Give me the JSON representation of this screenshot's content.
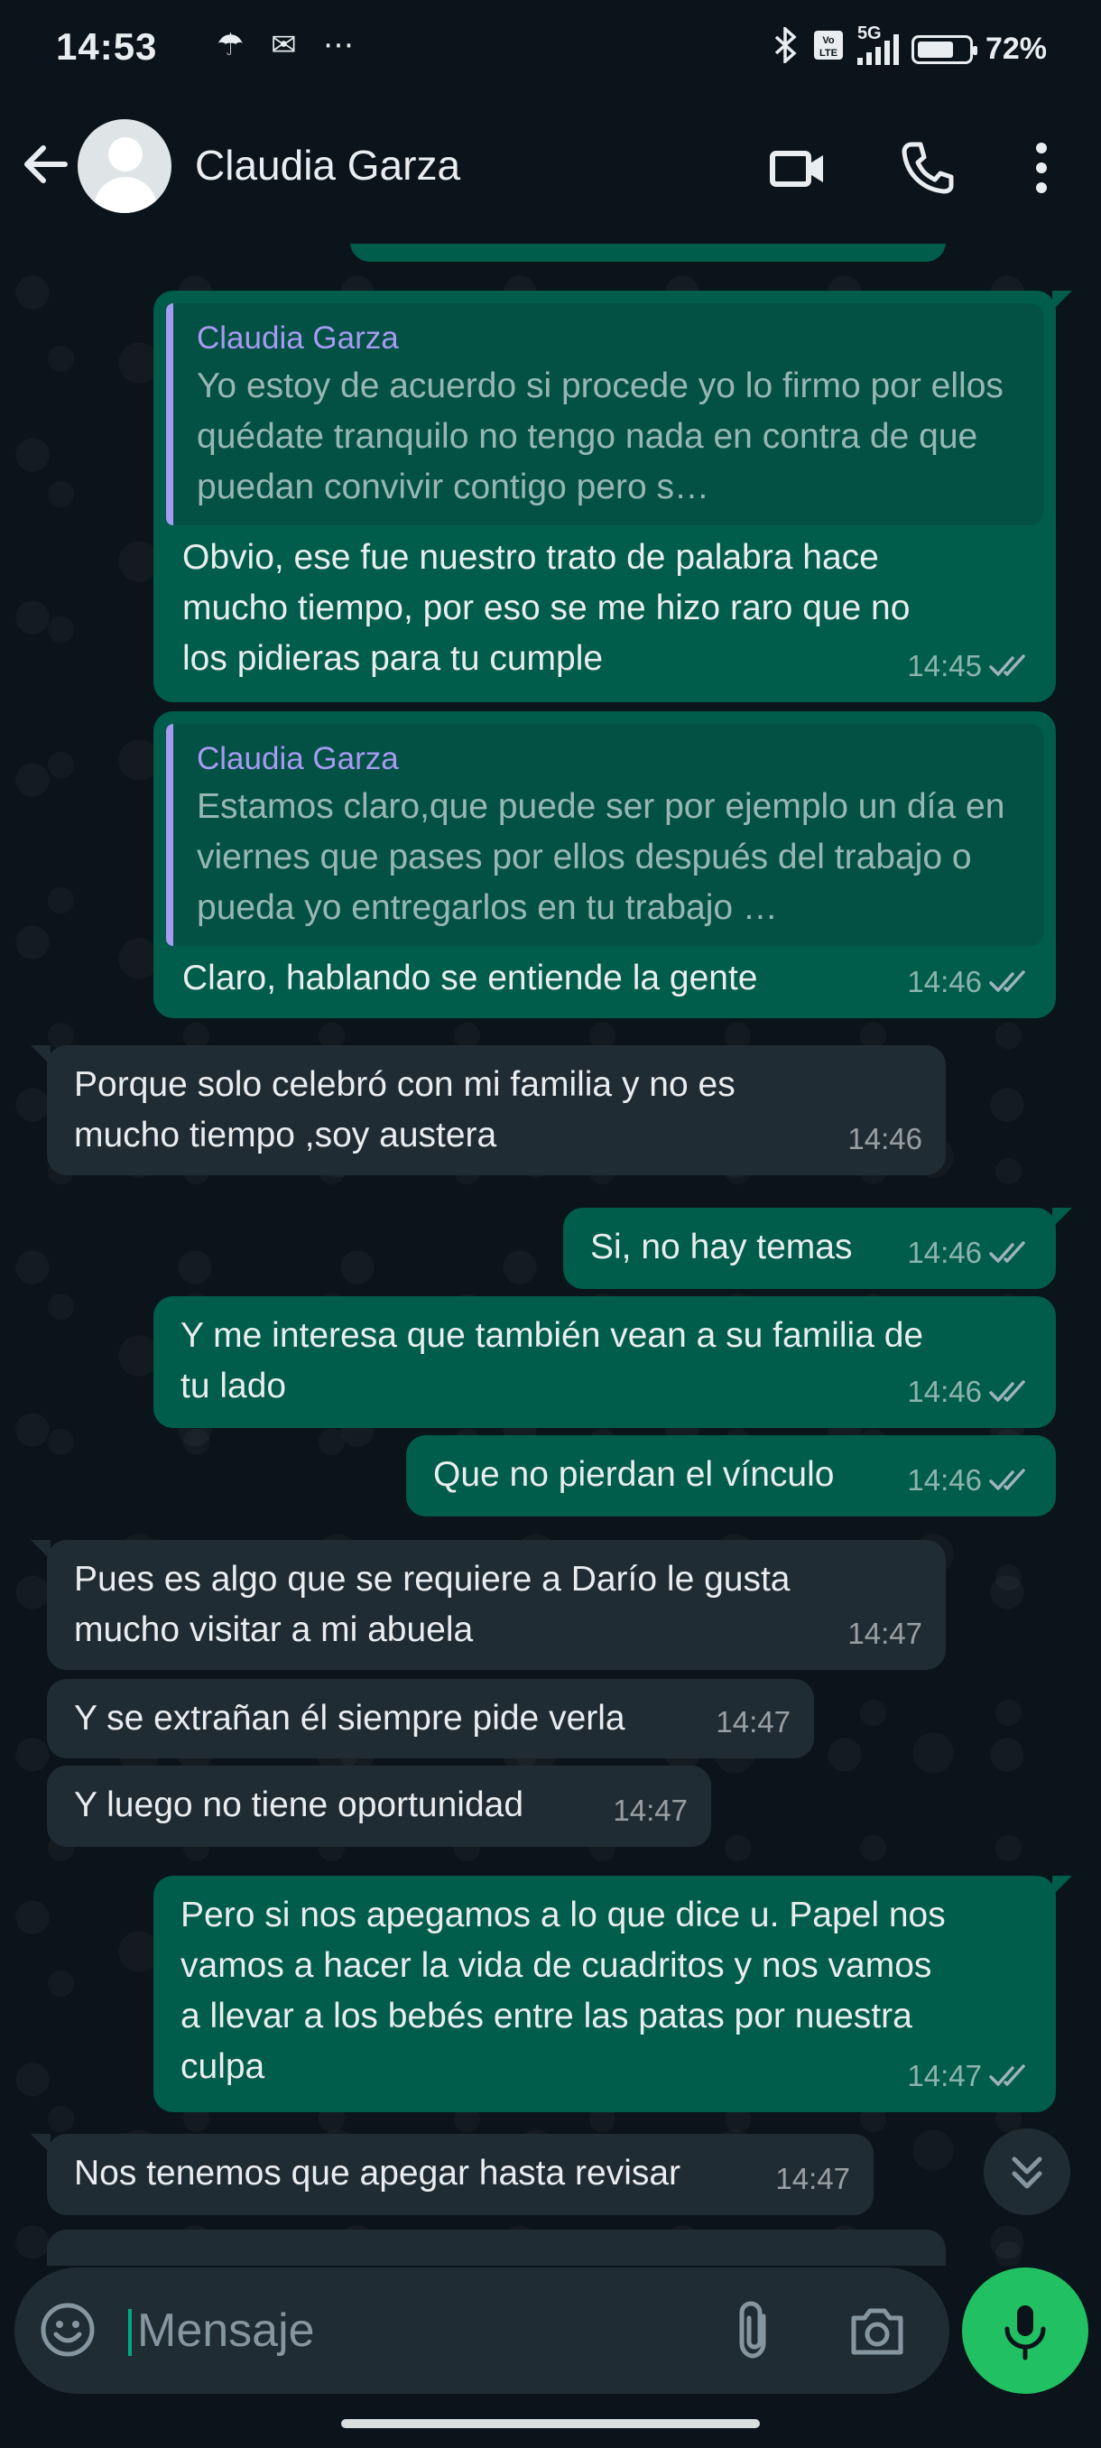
{
  "status_bar": {
    "time": "14:53",
    "battery_percent": "72%",
    "battery_level": 0.72,
    "network": "5G",
    "icons": [
      "bluetooth-icon",
      "volte-icon",
      "signal-icon",
      "battery-icon"
    ],
    "left_icons": [
      "weather-icon",
      "notification-icon",
      "more-dots-icon"
    ]
  },
  "header": {
    "contact_name": "Claudia Garza",
    "icons": [
      "back-arrow-icon",
      "avatar",
      "video-call-icon",
      "phone-icon",
      "more-vert-icon"
    ]
  },
  "colors": {
    "background": "#0b141a",
    "outgoing_bubble": "#005c4b",
    "incoming_bubble": "#202c33",
    "quote_accent": "#a79af1",
    "read_ticks": "#9fb3bd",
    "mic_button": "#21c063"
  },
  "messages": [
    {
      "direction": "out",
      "quote_author": "Claudia Garza",
      "quote_text": "Yo estoy de acuerdo si procede yo lo firmo por ellos quédate tranquilo no tengo nada en contra de que puedan convivir contigo pero s…",
      "text": "Obvio, ese fue nuestro trato de palabra hace\nmucho tiempo, por eso se me hizo raro que no\nlos pidieras para tu cumple",
      "time": "14:45",
      "status": "read"
    },
    {
      "direction": "out",
      "quote_author": "Claudia Garza",
      "quote_text": "Estamos claro,que puede ser por ejemplo un día en viernes que pases por ellos después del trabajo o pueda yo entregarlos en tu trabajo …",
      "text": "Claro, hablando se entiende la gente",
      "time": "14:46",
      "status": "read"
    },
    {
      "direction": "in",
      "text": "Porque solo celebró con mi familia y no es\nmucho tiempo ,soy austera",
      "time": "14:46"
    },
    {
      "direction": "out",
      "text": "Si, no hay temas",
      "time": "14:46",
      "status": "read"
    },
    {
      "direction": "out",
      "text": "Y me interesa que también vean a su familia de\ntu lado",
      "time": "14:46",
      "status": "read"
    },
    {
      "direction": "out",
      "text": "Que no pierdan el vínculo",
      "time": "14:46",
      "status": "read"
    },
    {
      "direction": "in",
      "text": "Pues es algo que se requiere a Darío le gusta\nmucho visitar a mi abuela",
      "time": "14:47"
    },
    {
      "direction": "in",
      "text": "Y se extrañan él siempre pide verla",
      "time": "14:47"
    },
    {
      "direction": "in",
      "text": "Y luego no tiene oportunidad",
      "time": "14:47"
    },
    {
      "direction": "out",
      "text": "Pero si nos apegamos a lo que dice u. Papel nos\nvamos a hacer la vida de cuadritos y nos vamos\na llevar a los bebés entre las patas por nuestra\nculpa",
      "time": "14:47",
      "status": "read"
    },
    {
      "direction": "in",
      "text": "Nos tenemos que apegar hasta revisar",
      "time": "14:47"
    }
  ],
  "composer": {
    "placeholder": "Mensaje",
    "icons": [
      "emoji-icon",
      "attach-icon",
      "camera-icon",
      "mic-icon"
    ]
  },
  "scroll_button_icon": "double-chevron-down-icon"
}
